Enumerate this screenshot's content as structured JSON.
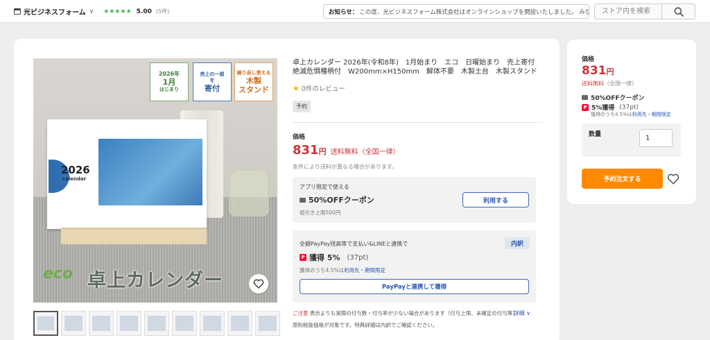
{
  "header": {
    "store_name": "光ビジネスフォーム",
    "rating_stars": "★★★★★",
    "rating": "5.00",
    "rating_count": "(5件)",
    "notice_label": "お知らせ：",
    "notice_text": "この度、光ビジネスフォーム株式会社はオンラインショップを開設いたしました。 みな…",
    "search_placeholder": "ストア内を検索"
  },
  "product_image": {
    "badge1_line1": "2026年",
    "badge1_line2": "1月",
    "badge1_line3": "はじまり",
    "badge2_line1": "売上の一部",
    "badge2_line2": "を",
    "badge2_line3": "寄付",
    "badge3_line1": "繰り返し使える",
    "badge3_line2": "木製",
    "badge3_line3": "スタンド",
    "cal_year": "2026",
    "cal_word": "calendar",
    "eco_word": "eco",
    "eco_title": "卓上カレンダー",
    "thumb_count": 9
  },
  "info": {
    "title": "卓上カレンダー 2026年(令和8年)　1月始まり　エコ　日曜始まり　売上寄付　絶滅危惧種柄付　W200mm×H150mm　解体不要　木製土台　木製スタンド",
    "review_text": "0件のレビュー",
    "preorder_tag": "予約",
    "price_label": "価格",
    "price": "831",
    "yen": "円",
    "shipping": "送料無料（全国一律）",
    "condition": "条件により送料が異なる場合があります。",
    "coupon_label": "アプリ限定で使える",
    "coupon_title": "50%OFFクーポン",
    "coupon_limit": "値引き上限500円",
    "coupon_btn": "利用する",
    "point_label": "全額PayPay残高等で支払い&LINEと連携で",
    "uchiwake": "内訳",
    "point_main": "獲得 5%",
    "point_pt": "(37pt)",
    "point_sub_prefix": "獲得のうち4.5%は",
    "point_sub_link": "利用先・期間限定",
    "paypay_btn": "PayPayと連携して獲得",
    "note_red": "ご注意",
    "note_text": "表示よりも実際の付与数・付与率が少ない場合があります（付与上限、未確定の付与等）",
    "detail": "詳細",
    "note2": "原則税抜価格が対象です。特典詳細は内訳でご確認ください。"
  },
  "side": {
    "price_label": "価格",
    "price": "831",
    "yen": "円",
    "ship": "送料無料",
    "ship_sub": "（全国一律）",
    "coupon": "50%OFFクーポン",
    "point": "5%獲得",
    "point_pt": "(37pt)",
    "sub_prefix": "獲得のうち4.5%は",
    "sub_link": "利用先・期間限定",
    "qty_label": "数量",
    "qty_value": "1",
    "order_btn": "予約注文する"
  },
  "colors": {
    "accent_red": "#c9353a",
    "order_orange": "#ff8a00",
    "link_blue": "#2b58ae",
    "star_green": "#3fb24d"
  }
}
